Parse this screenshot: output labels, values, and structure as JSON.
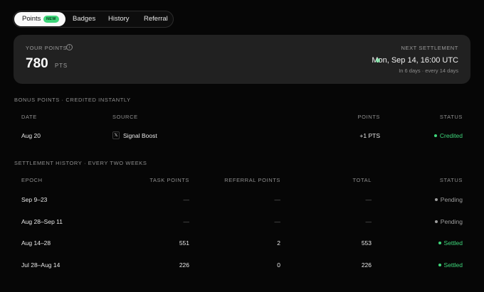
{
  "tabs": [
    {
      "label": "Points",
      "badge": "NEW"
    },
    {
      "label": "Badges"
    },
    {
      "label": "History"
    },
    {
      "label": "Referral"
    }
  ],
  "points_card": {
    "label": "YOUR POINTS",
    "value": "780",
    "unit": "PTS",
    "next_label": "NEXT SETTLEMENT",
    "next_date": "Mon, Sep 14, 16:00 UTC",
    "next_sub": "In 6 days · every 14 days"
  },
  "bonus": {
    "title": "BONUS POINTS · CREDITED INSTANTLY",
    "columns": {
      "date": "DATE",
      "source": "SOURCE",
      "points": "POINTS",
      "status": "STATUS"
    },
    "rows": [
      {
        "date": "Aug 20",
        "source": "Signal Boost",
        "source_icon": "x-logo-icon",
        "points": "+1 PTS",
        "status": "Credited",
        "status_color": "#3ed67a"
      }
    ]
  },
  "settlement": {
    "title": "SETTLEMENT HISTORY · EVERY TWO WEEKS",
    "columns": {
      "epoch": "EPOCH",
      "task": "TASK POINTS",
      "referral": "REFERRAL POINTS",
      "total": "TOTAL",
      "status": "STATUS"
    },
    "rows": [
      {
        "epoch": "Sep 9–23",
        "task": "—",
        "referral": "—",
        "total": "—",
        "status": "Pending"
      },
      {
        "epoch": "Aug 28–Sep 11",
        "task": "—",
        "referral": "—",
        "total": "—",
        "status": "Pending"
      },
      {
        "epoch": "Aug 14–28",
        "task": "551",
        "referral": "2",
        "total": "553",
        "status": "Settled"
      },
      {
        "epoch": "Jul 28–Aug 14",
        "task": "226",
        "referral": "0",
        "total": "226",
        "status": "Settled"
      }
    ]
  },
  "colors": {
    "accent_green": "#3ed67a",
    "pending_gray": "#9d9d9d",
    "card_bg": "#212121",
    "page_bg": "#060606"
  }
}
